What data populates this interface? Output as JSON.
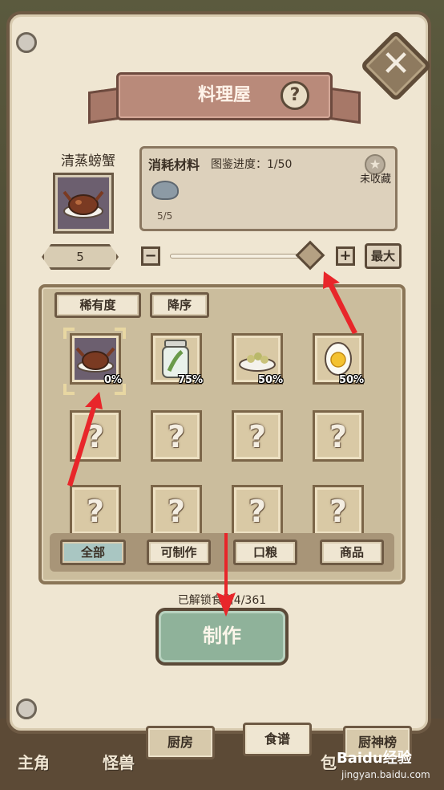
{
  "header": {
    "title": "料理屋"
  },
  "dish": {
    "name": "清蒸螃蟹",
    "quantity": "5"
  },
  "materials": {
    "title": "消耗材料",
    "progress_label": "图鉴进度：1/50",
    "fav_label": "未收藏",
    "count": "5/5"
  },
  "controls": {
    "minus": "−",
    "plus": "+",
    "max_label": "最大",
    "slider_fraction": 0.97
  },
  "sort": {
    "rarity": "稀有度",
    "order": "降序"
  },
  "recipes": [
    {
      "icon": "steamed-crab-icon",
      "percent": "0%"
    },
    {
      "icon": "pickle-jar-icon",
      "percent": "75%"
    },
    {
      "icon": "sprout-dish-icon",
      "percent": "50%"
    },
    {
      "icon": "boiled-egg-icon",
      "percent": "50%"
    }
  ],
  "locked_symbol": "?",
  "filters": {
    "all": "全部",
    "craftable": "可制作",
    "ration": "口粮",
    "goods": "商品"
  },
  "unlock_text": "已解锁食谱4/361",
  "make_label": "制作",
  "bottom_nav": {
    "hero": "主角",
    "monster": "怪兽",
    "bag": "包"
  },
  "tabs": {
    "kitchen": "厨房",
    "recipes": "食谱",
    "chef_rank": "厨神榜"
  },
  "watermark": {
    "brand": "Baidu经验",
    "url": "jingyan.baidu.com"
  },
  "colors": {
    "panel": "#efe6d2",
    "ribbon": "#b98a7a",
    "make": "#8fb29a",
    "arrow": "#e8262a"
  }
}
